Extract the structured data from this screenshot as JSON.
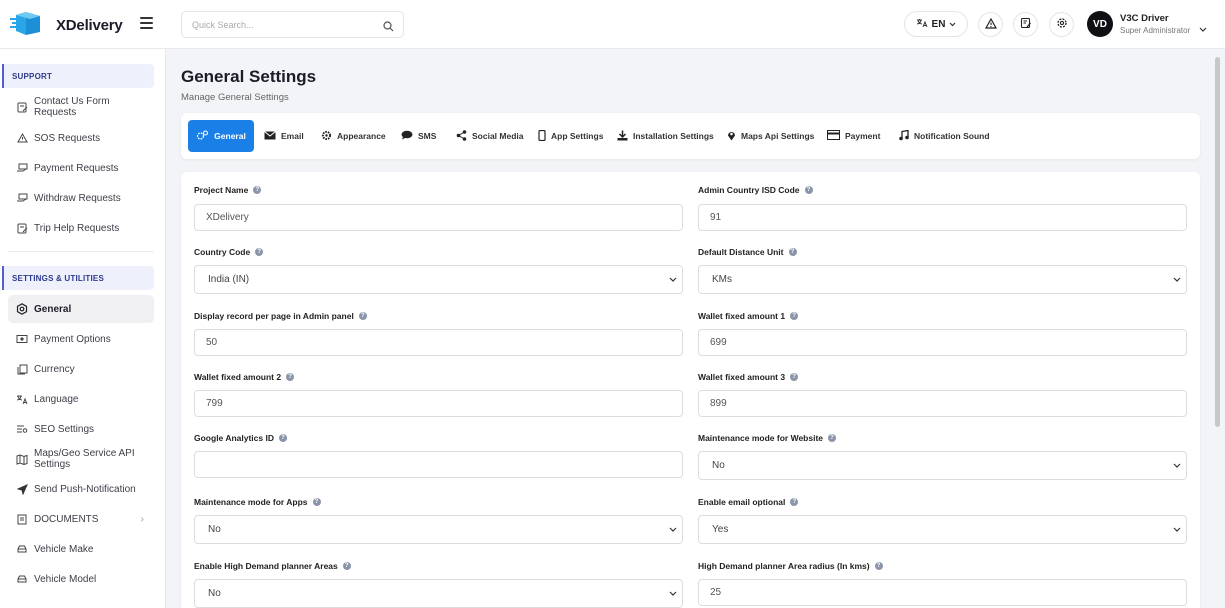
{
  "app": {
    "name": "XDelivery"
  },
  "header": {
    "search_placeholder": "Quick Search...",
    "language": "EN",
    "user_initials": "VD",
    "user_name": "V3C Driver",
    "user_role": "Super Administrator"
  },
  "sidebar": {
    "support_heading": "SUPPORT",
    "support_items": [
      {
        "label": "Contact Us Form Requests",
        "icon": "edit-square-icon"
      },
      {
        "label": "SOS Requests",
        "icon": "warning-triangle-icon"
      },
      {
        "label": "Payment Requests",
        "icon": "cash-hand-icon"
      },
      {
        "label": "Withdraw Requests",
        "icon": "cash-hand-icon"
      },
      {
        "label": "Trip Help Requests",
        "icon": "edit-square-icon"
      }
    ],
    "settings_heading": "SETTINGS & UTILITIES",
    "settings_items": [
      {
        "label": "General",
        "icon": "gear-icon"
      },
      {
        "label": "Payment Options",
        "icon": "money-icon"
      },
      {
        "label": "Currency",
        "icon": "copy-icon"
      },
      {
        "label": "Language",
        "icon": "translate-icon"
      },
      {
        "label": "SEO Settings",
        "icon": "seo-icon"
      },
      {
        "label": "Maps/Geo Service API Settings",
        "icon": "map-icon"
      },
      {
        "label": "Send Push-Notification",
        "icon": "send-icon"
      },
      {
        "label": "DOCUMENTS",
        "icon": "document-icon"
      },
      {
        "label": "Vehicle Make",
        "icon": "car-icon"
      },
      {
        "label": "Vehicle Model",
        "icon": "car-icon"
      }
    ]
  },
  "page": {
    "title": "General Settings",
    "subtitle": "Manage General Settings"
  },
  "tabs": [
    {
      "label": "General",
      "icon": "gears-icon"
    },
    {
      "label": "Email",
      "icon": "envelope-icon"
    },
    {
      "label": "Appearance",
      "icon": "cog-icon"
    },
    {
      "label": "SMS",
      "icon": "chat-bubble-icon"
    },
    {
      "label": "Social Media",
      "icon": "share-icon"
    },
    {
      "label": "App Settings",
      "icon": "mobile-icon"
    },
    {
      "label": "Installation Settings",
      "icon": "download-icon"
    },
    {
      "label": "Maps Api Settings",
      "icon": "map-pin-icon"
    },
    {
      "label": "Payment",
      "icon": "credit-card-icon"
    },
    {
      "label": "Notification Sound",
      "icon": "music-note-icon"
    }
  ],
  "form": {
    "project_name": {
      "label": "Project Name",
      "value": "XDelivery"
    },
    "admin_isd": {
      "label": "Admin Country ISD Code",
      "value": "91"
    },
    "country_code": {
      "label": "Country Code",
      "value": "India (IN)"
    },
    "distance_unit": {
      "label": "Default Distance Unit",
      "value": "KMs"
    },
    "records_per_page": {
      "label": "Display record per page in Admin panel",
      "value": "50"
    },
    "wallet_1": {
      "label": "Wallet fixed amount 1",
      "value": "699"
    },
    "wallet_2": {
      "label": "Wallet fixed amount 2",
      "value": "799"
    },
    "wallet_3": {
      "label": "Wallet fixed amount 3",
      "value": "899"
    },
    "google_analytics": {
      "label": "Google Analytics ID",
      "value": ""
    },
    "maint_website": {
      "label": "Maintenance mode for Website",
      "value": "No"
    },
    "maint_apps": {
      "label": "Maintenance mode for Apps",
      "value": "No"
    },
    "email_optional": {
      "label": "Enable email optional",
      "value": "Yes"
    },
    "high_demand": {
      "label": "Enable High Demand planner Areas",
      "value": "No"
    },
    "high_demand_radius": {
      "label": "High Demand planner Area radius (In kms)",
      "value": "25"
    }
  },
  "colors": {
    "accent": "#1a7fe6",
    "logo_blue": "#2aa6e8",
    "section_accent": "#4d5fd1"
  }
}
